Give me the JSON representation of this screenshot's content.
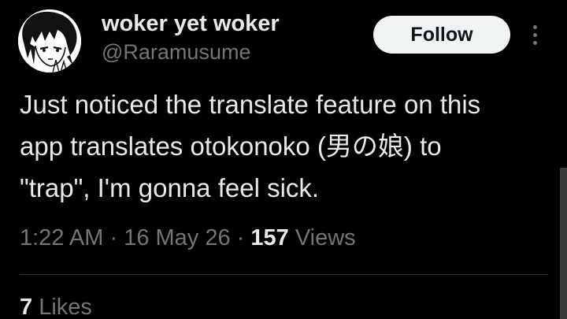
{
  "author": {
    "display_name": "woker yet woker",
    "handle": "@Raramusume",
    "avatar_icon": "anime-character-avatar-icon"
  },
  "actions": {
    "follow_label": "Follow",
    "more_icon": "more-vertical-icon"
  },
  "tweet": {
    "lines": [
      "Just noticed the translate feature on this",
      "app translates otokonoko (男の娘) to",
      "\"trap\", I'm gonna feel sick."
    ]
  },
  "meta": {
    "time": "1:22 AM",
    "separator": " · ",
    "date": "16 May 26",
    "views_count": "157",
    "views_label": " Views"
  },
  "engagement": {
    "likes_count": "7",
    "likes_label": " Likes"
  },
  "colors": {
    "background": "#000000",
    "primary_text": "#e7e9ea",
    "secondary_text": "#71767b",
    "follow_bg": "#eff3f4",
    "divider": "#2f3336"
  }
}
